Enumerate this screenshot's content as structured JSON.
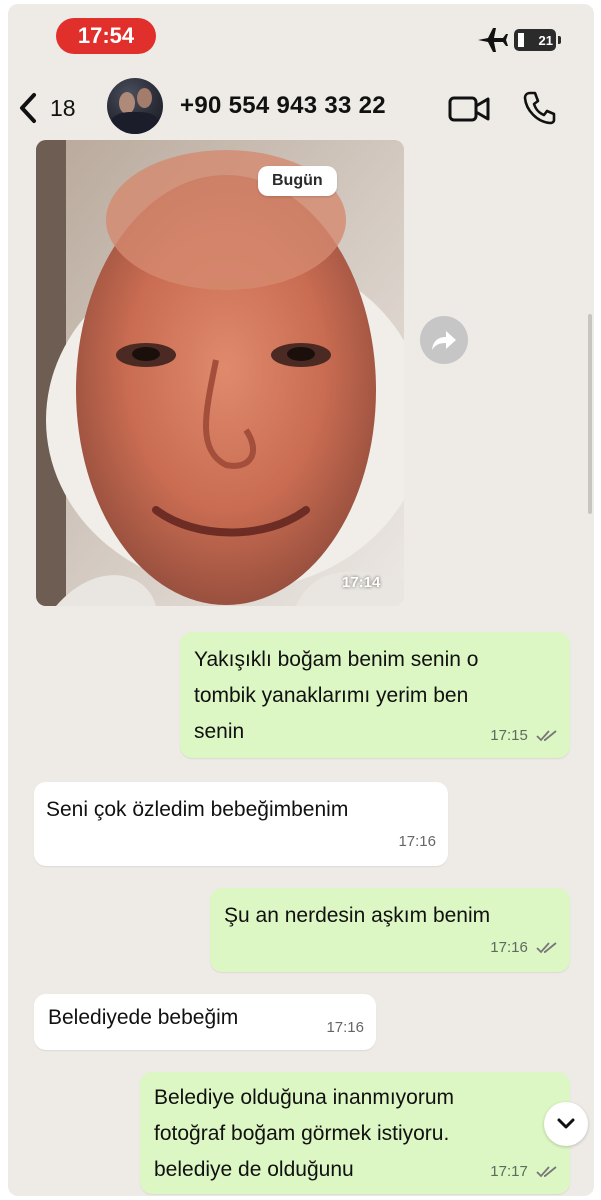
{
  "status_bar": {
    "time": "17:54",
    "battery": "21",
    "airplane_icon": "airplane-icon"
  },
  "header": {
    "back_count": "18",
    "contact": "+90 554 943 33 22",
    "icons": [
      "chevron-left-icon",
      "video-call-icon",
      "phone-call-icon"
    ]
  },
  "chat": {
    "date_label": "Bugün",
    "photo": {
      "time": "17:14"
    },
    "messages": [
      {
        "dir": "out",
        "lines": [
          "Yakışıklı boğam benim senin o",
          "tombik yanaklarımı yerim ben",
          "senin"
        ],
        "time": "17:15",
        "read": true
      },
      {
        "dir": "in",
        "lines": [
          "Seni çok özledim bebeğimbenim"
        ],
        "time": "17:16"
      },
      {
        "dir": "out",
        "lines": [
          "Şu an nerdesin aşkım benim"
        ],
        "time": "17:16",
        "read": true
      },
      {
        "dir": "in",
        "lines": [
          "Belediyede bebeğim"
        ],
        "time": "17:16"
      },
      {
        "dir": "out",
        "lines": [
          "Belediye olduğuna inanmıyorum",
          "fotoğraf boğam görmek istiyoru.",
          "belediye de olduğunu"
        ],
        "time": "17:17",
        "read": true
      }
    ]
  },
  "colors": {
    "outgoing_bubble": "#dcf6c4",
    "incoming_bubble": "#ffffff",
    "chat_background": "#eeebe6",
    "time_pill": "#e1302c"
  }
}
